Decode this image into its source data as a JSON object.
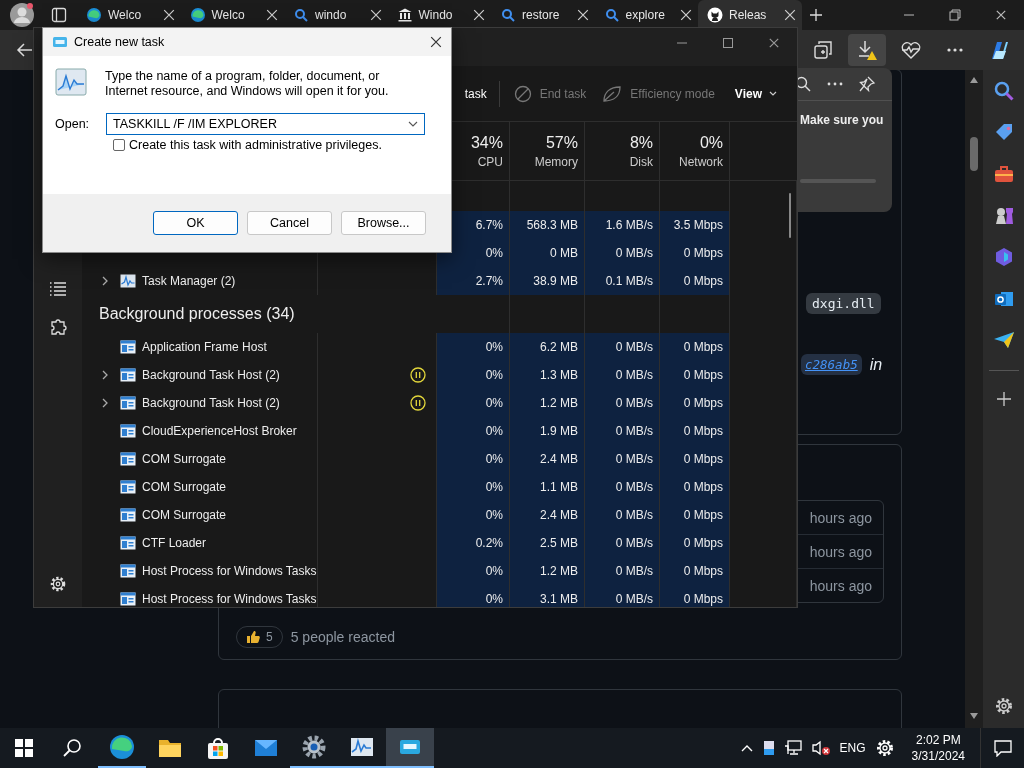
{
  "browser": {
    "tabs": [
      {
        "label": "Welco",
        "kind": "edge",
        "selected": false
      },
      {
        "label": "Welco",
        "kind": "edge",
        "selected": false
      },
      {
        "label": "windo",
        "kind": "search",
        "selected": false
      },
      {
        "label": "Windo",
        "kind": "bank",
        "selected": false
      },
      {
        "label": "restore",
        "kind": "search",
        "selected": false
      },
      {
        "label": "explore",
        "kind": "search",
        "selected": false
      },
      {
        "label": "Releas",
        "kind": "github",
        "selected": true
      }
    ],
    "popup": {
      "text": "Make sure you"
    },
    "page": {
      "code": "dxgi.dll",
      "commit_link": "c286ab5",
      "commit_suffix": "in",
      "times": [
        "hours ago",
        "hours ago",
        "hours ago"
      ],
      "reaction_count": "5",
      "reaction_summary": "5 people reacted"
    }
  },
  "task_manager": {
    "toolbar": [
      {
        "label": "task",
        "kind": "plain",
        "disabled": false
      },
      {
        "label": "End task",
        "kind": "end",
        "disabled": true
      },
      {
        "label": "Efficiency mode",
        "kind": "leaf",
        "disabled": true
      }
    ],
    "view": "View",
    "columns": [
      {
        "percent": "34%",
        "label": "CPU"
      },
      {
        "percent": "57%",
        "label": "Memory"
      },
      {
        "percent": "8%",
        "label": "Disk"
      },
      {
        "percent": "0%",
        "label": "Network"
      }
    ],
    "apps": [
      {
        "values": [
          "6.7%",
          "568.3 MB",
          "1.6 MB/s",
          "3.5 Mbps"
        ]
      },
      {
        "values": [
          "0%",
          "0 MB",
          "0 MB/s",
          "0 Mbps"
        ]
      },
      {
        "name": "Task Manager (2)",
        "expandable": true,
        "suspended": false,
        "values": [
          "2.7%",
          "38.9 MB",
          "0.1 MB/s",
          "0 Mbps"
        ]
      }
    ],
    "background": {
      "title": "Background processes (34)",
      "rows": [
        {
          "name": "Application Frame Host",
          "expandable": false,
          "suspended": false,
          "values": [
            "0%",
            "6.2 MB",
            "0 MB/s",
            "0 Mbps"
          ]
        },
        {
          "name": "Background Task Host (2)",
          "expandable": true,
          "suspended": true,
          "values": [
            "0%",
            "1.3 MB",
            "0 MB/s",
            "0 Mbps"
          ]
        },
        {
          "name": "Background Task Host (2)",
          "expandable": true,
          "suspended": true,
          "values": [
            "0%",
            "1.2 MB",
            "0 MB/s",
            "0 Mbps"
          ]
        },
        {
          "name": "CloudExperienceHost Broker",
          "expandable": false,
          "suspended": false,
          "values": [
            "0%",
            "1.9 MB",
            "0 MB/s",
            "0 Mbps"
          ]
        },
        {
          "name": "COM Surrogate",
          "expandable": false,
          "suspended": false,
          "values": [
            "0%",
            "2.4 MB",
            "0 MB/s",
            "0 Mbps"
          ]
        },
        {
          "name": "COM Surrogate",
          "expandable": false,
          "suspended": false,
          "values": [
            "0%",
            "1.1 MB",
            "0 MB/s",
            "0 Mbps"
          ]
        },
        {
          "name": "COM Surrogate",
          "expandable": false,
          "suspended": false,
          "values": [
            "0%",
            "2.4 MB",
            "0 MB/s",
            "0 Mbps"
          ]
        },
        {
          "name": "CTF Loader",
          "expandable": false,
          "suspended": false,
          "values": [
            "0.2%",
            "2.5 MB",
            "0 MB/s",
            "0 Mbps"
          ]
        },
        {
          "name": "Host Process for Windows Tasks",
          "expandable": false,
          "suspended": false,
          "values": [
            "0%",
            "1.2 MB",
            "0 MB/s",
            "0 Mbps"
          ]
        },
        {
          "name": "Host Process for Windows Tasks",
          "expandable": false,
          "suspended": false,
          "values": [
            "0%",
            "3.1 MB",
            "0 MB/s",
            "0 Mbps"
          ]
        }
      ]
    }
  },
  "dialog": {
    "title": "Create new task",
    "message": "Type the name of a program, folder, document, or Internet resource, and Windows will open it for you.",
    "open_label": "Open:",
    "value": "TASKKILL /F /IM EXPLORER",
    "admin": {
      "label": "Create this task with administrative privileges.",
      "checked": false
    },
    "buttons": [
      {
        "label": "OK",
        "default": true
      },
      {
        "label": "Cancel",
        "default": false
      },
      {
        "label": "Browse...",
        "default": false
      }
    ]
  },
  "taskbar": {
    "apps": [
      {
        "kind": "edge",
        "running": true,
        "selected": false
      },
      {
        "kind": "folder",
        "running": false,
        "selected": false
      },
      {
        "kind": "store",
        "running": false,
        "selected": false
      },
      {
        "kind": "mail",
        "running": false,
        "selected": false
      },
      {
        "kind": "settings",
        "running": true,
        "selected": false
      },
      {
        "kind": "chart",
        "running": true,
        "selected": false
      },
      {
        "kind": "run",
        "running": true,
        "selected": true
      }
    ],
    "language": "ENG",
    "time": "2:02 PM",
    "date": "3/31/2024"
  }
}
